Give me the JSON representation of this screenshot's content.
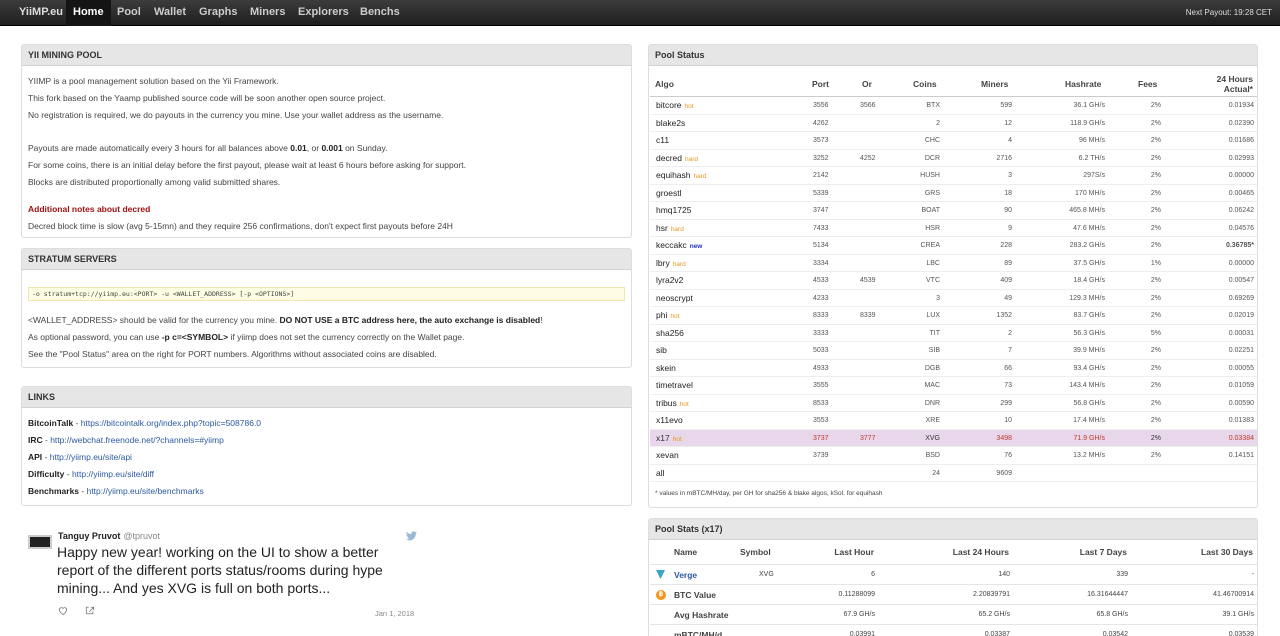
{
  "nav": {
    "brand": "YiiMP.eu",
    "items": [
      "Home",
      "Pool",
      "Wallet",
      "Graphs",
      "Miners",
      "Explorers",
      "Benchs"
    ],
    "next_payout": "Next Payout: 19:28 CET"
  },
  "intro": {
    "title": "YII MINING POOL",
    "p1": "YIIMP is a pool management solution based on the Yii Framework.",
    "p2": "This fork based on the Yaamp published source code will be soon another open source project.",
    "p3": "No registration is required, we do payouts in the currency you mine. Use your wallet address as the username.",
    "p4a": "Payouts are made automatically every 3 hours for all balances above ",
    "p4b": "0.01",
    "p4c": ", or ",
    "p4d": "0.001",
    "p4e": " on Sunday.",
    "p5": "For some coins, there is an initial delay before the first payout, please wait at least 6 hours before asking for support.",
    "p6": "Blocks are distributed proportionally among valid submitted shares.",
    "notes_title": "Additional notes about decred",
    "notes_text": "Decred block time is slow (avg 5-15mn) and they require 256 confirmations, don't expect first payouts before 24H"
  },
  "stratum": {
    "title": "STRATUM SERVERS",
    "command": "-o stratum+tcp://yiimp.eu:<PORT> -u <WALLET_ADDRESS> [-p <OPTIONS>]",
    "l1a": "<WALLET_ADDRESS> should be valid for the currency you mine. ",
    "l1b": "DO NOT USE a BTC address here, the auto exchange is disabled",
    "l1c": "!",
    "l2a": "As optional password, you can use ",
    "l2b": "-p c=<SYMBOL>",
    "l2c": " if yiimp does not set the currency correctly on the Wallet page.",
    "l3": "See the \"Pool Status\" area on the right for PORT numbers. Algorithms without associated coins are disabled."
  },
  "links": {
    "title": "LINKS",
    "items": [
      {
        "label": "BitcoinTalk",
        "sep": " - ",
        "url": "https://bitcointalk.org/index.php?topic=508786.0"
      },
      {
        "label": "IRC",
        "sep": " - ",
        "url": "http://webchat.freenode.net/?channels=#yiimp"
      },
      {
        "label": "API",
        "sep": " - ",
        "url": "http://yiimp.eu/site/api"
      },
      {
        "label": "Difficulty",
        "sep": " - ",
        "url": "http://yiimp.eu/site/diff"
      },
      {
        "label": "Benchmarks",
        "sep": " - ",
        "url": "http://yiimp.eu/site/benchmarks"
      }
    ]
  },
  "tweet": {
    "name": "Tanguy Pruvot",
    "handle": "@tpruvot",
    "text": "Happy new year! working on the UI to show a better report of the different ports status/rooms during hype mining... And yes XVG is full on both ports...",
    "date": "Jan 1, 2018"
  },
  "pool_status": {
    "title": "Pool Status",
    "headers": [
      "Algo",
      "Port",
      "Or",
      "Coins",
      "Miners",
      "Hashrate",
      "Fees",
      "24 Hours",
      "Actual*"
    ],
    "rows": [
      {
        "algo": "bitcore",
        "tag": "hot",
        "port": "3556",
        "or": "3566",
        "coins": "BTX",
        "miners": "599",
        "hashrate": "36.1 GH/s",
        "fees": "2%",
        "actual": "0.01934"
      },
      {
        "algo": "blake2s",
        "tag": "",
        "port": "4262",
        "or": "",
        "coins": "2",
        "miners": "12",
        "hashrate": "118.9 GH/s",
        "fees": "2%",
        "actual": "0.02390"
      },
      {
        "algo": "c11",
        "tag": "",
        "port": "3573",
        "or": "",
        "coins": "CHC",
        "miners": "4",
        "hashrate": "96 MH/s",
        "fees": "2%",
        "actual": "0.01686"
      },
      {
        "algo": "decred",
        "tag": "hard",
        "port": "3252",
        "or": "4252",
        "coins": "DCR",
        "miners": "2716",
        "hashrate": "6.2 TH/s",
        "fees": "2%",
        "actual": "0.02993"
      },
      {
        "algo": "equihash",
        "tag": "hard",
        "port": "2142",
        "or": "",
        "coins": "HUSH",
        "miners": "3",
        "hashrate": "297S/s",
        "fees": "2%",
        "actual": "0.00000"
      },
      {
        "algo": "groestl",
        "tag": "",
        "port": "5339",
        "or": "",
        "coins": "GRS",
        "miners": "18",
        "hashrate": "170 MH/s",
        "fees": "2%",
        "actual": "0.00465"
      },
      {
        "algo": "hmq1725",
        "tag": "",
        "port": "3747",
        "or": "",
        "coins": "BOAT",
        "miners": "90",
        "hashrate": "465.8 MH/s",
        "fees": "2%",
        "actual": "0.06242"
      },
      {
        "algo": "hsr",
        "tag": "hard",
        "port": "7433",
        "or": "",
        "coins": "HSR",
        "miners": "9",
        "hashrate": "47.6 MH/s",
        "fees": "2%",
        "actual": "0.04576"
      },
      {
        "algo": "keccakc",
        "tag": "new",
        "port": "5134",
        "or": "",
        "coins": "CREA",
        "miners": "228",
        "hashrate": "283.2 GH/s",
        "fees": "2%",
        "actual": "0.36785*"
      },
      {
        "algo": "lbry",
        "tag": "hard",
        "port": "3334",
        "or": "",
        "coins": "LBC",
        "miners": "89",
        "hashrate": "37.5 GH/s",
        "fees": "1%",
        "actual": "0.00000"
      },
      {
        "algo": "lyra2v2",
        "tag": "",
        "port": "4533",
        "or": "4539",
        "coins": "VTC",
        "miners": "409",
        "hashrate": "18.4 GH/s",
        "fees": "2%",
        "actual": "0.00547"
      },
      {
        "algo": "neoscrypt",
        "tag": "",
        "port": "4233",
        "or": "",
        "coins": "3",
        "miners": "49",
        "hashrate": "129.3 MH/s",
        "fees": "2%",
        "actual": "0.69269"
      },
      {
        "algo": "phi",
        "tag": "hot",
        "port": "8333",
        "or": "8339",
        "coins": "LUX",
        "miners": "1352",
        "hashrate": "83.7 GH/s",
        "fees": "2%",
        "actual": "0.02019"
      },
      {
        "algo": "sha256",
        "tag": "",
        "port": "3333",
        "or": "",
        "coins": "TIT",
        "miners": "2",
        "hashrate": "56.3 GH/s",
        "fees": "5%",
        "actual": "0.00031"
      },
      {
        "algo": "sib",
        "tag": "",
        "port": "5033",
        "or": "",
        "coins": "SIB",
        "miners": "7",
        "hashrate": "39.9 MH/s",
        "fees": "2%",
        "actual": "0.02251"
      },
      {
        "algo": "skein",
        "tag": "",
        "port": "4933",
        "or": "",
        "coins": "DGB",
        "miners": "66",
        "hashrate": "93.4 GH/s",
        "fees": "2%",
        "actual": "0.00055"
      },
      {
        "algo": "timetravel",
        "tag": "",
        "port": "3555",
        "or": "",
        "coins": "MAC",
        "miners": "73",
        "hashrate": "143.4 MH/s",
        "fees": "2%",
        "actual": "0.01059"
      },
      {
        "algo": "tribus",
        "tag": "hot",
        "port": "8533",
        "or": "",
        "coins": "DNR",
        "miners": "299",
        "hashrate": "56.8 GH/s",
        "fees": "2%",
        "actual": "0.00590"
      },
      {
        "algo": "x11evo",
        "tag": "",
        "port": "3553",
        "or": "",
        "coins": "XRE",
        "miners": "10",
        "hashrate": "17.4 MH/s",
        "fees": "2%",
        "actual": "0.01383"
      },
      {
        "algo": "x17",
        "tag": "hot",
        "port": "3737",
        "or": "3777",
        "coins": "XVG",
        "miners": "3498",
        "hashrate": "71.9 GH/s",
        "fees": "2%",
        "actual": "0.03384",
        "highlight": true
      },
      {
        "algo": "xevan",
        "tag": "",
        "port": "3739",
        "or": "",
        "coins": "BSD",
        "miners": "76",
        "hashrate": "13.2 MH/s",
        "fees": "2%",
        "actual": "0.14151"
      },
      {
        "algo": "all",
        "tag": "",
        "port": "",
        "or": "",
        "coins": "24",
        "miners": "9609",
        "hashrate": "",
        "fees": "",
        "actual": ""
      }
    ],
    "footnote": "* values in mBTC/MH/day, per GH for sha256 & blake algos, kSol. for equihash"
  },
  "pool_stats": {
    "title": "Pool Stats (x17)",
    "headers": [
      "Name",
      "Symbol",
      "Last Hour",
      "Last 24 Hours",
      "Last 7 Days",
      "Last 30 Days"
    ],
    "rows": [
      {
        "name": "Verge",
        "symbol": "XVG",
        "h": "6",
        "d": "140",
        "w": "339",
        "m": "-",
        "link": true
      },
      {
        "name": "BTC Value",
        "symbol": "",
        "h": "0.11288099",
        "d": "2.20839791",
        "w": "16.31644447",
        "m": "41.46700914"
      },
      {
        "name": "Avg Hashrate",
        "symbol": "",
        "h": "67.9 GH/s",
        "d": "65.2 GH/s",
        "w": "65.8 GH/s",
        "m": "39.1 GH/s"
      },
      {
        "name": "mBTC/MH/d",
        "symbol": "",
        "h": "0.03991",
        "d": "0.03387",
        "w": "0.03542",
        "m": "0.03539"
      }
    ]
  }
}
